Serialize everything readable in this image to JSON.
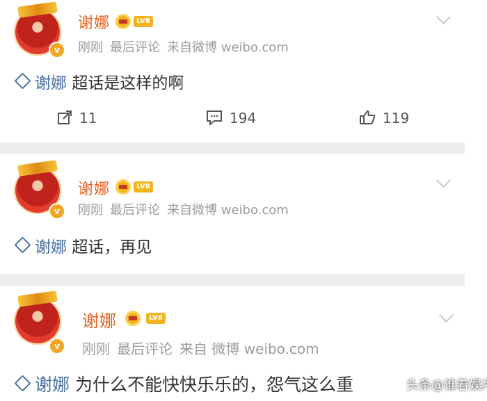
{
  "posts": [
    {
      "username": "谢娜",
      "level": "LV8",
      "verified_mark": "v",
      "meta": [
        "刚刚",
        "最后评论",
        "来自微博 weibo.com"
      ],
      "topic": "谢娜",
      "text": "超话是这样的啊",
      "actions": {
        "share": "11",
        "comment": "194",
        "like": "119"
      }
    },
    {
      "username": "谢娜",
      "level": "LV8",
      "verified_mark": "v",
      "meta": [
        "刚刚",
        "最后评论",
        "来自微博 weibo.com"
      ],
      "topic": "谢娜",
      "text": "超话，再见"
    },
    {
      "username": "谢娜",
      "level": "LV8",
      "verified_mark": "v",
      "meta": [
        "刚刚",
        "最后评论",
        "来自 微博 weibo.com"
      ],
      "topic": "谢娜",
      "text": "为什么不能快快乐乐的，怨气这么重"
    }
  ],
  "watermark": "头条@谁着娱片",
  "colors": {
    "username": "#e5631f",
    "topic": "#4a6fa5",
    "meta": "#9b9b9b",
    "separator": "#eeeeee"
  },
  "icons": [
    "share-icon",
    "comment-icon",
    "like-icon",
    "chevron-down-icon",
    "topic-diamond-icon",
    "crown-icon",
    "verified-icon"
  ]
}
